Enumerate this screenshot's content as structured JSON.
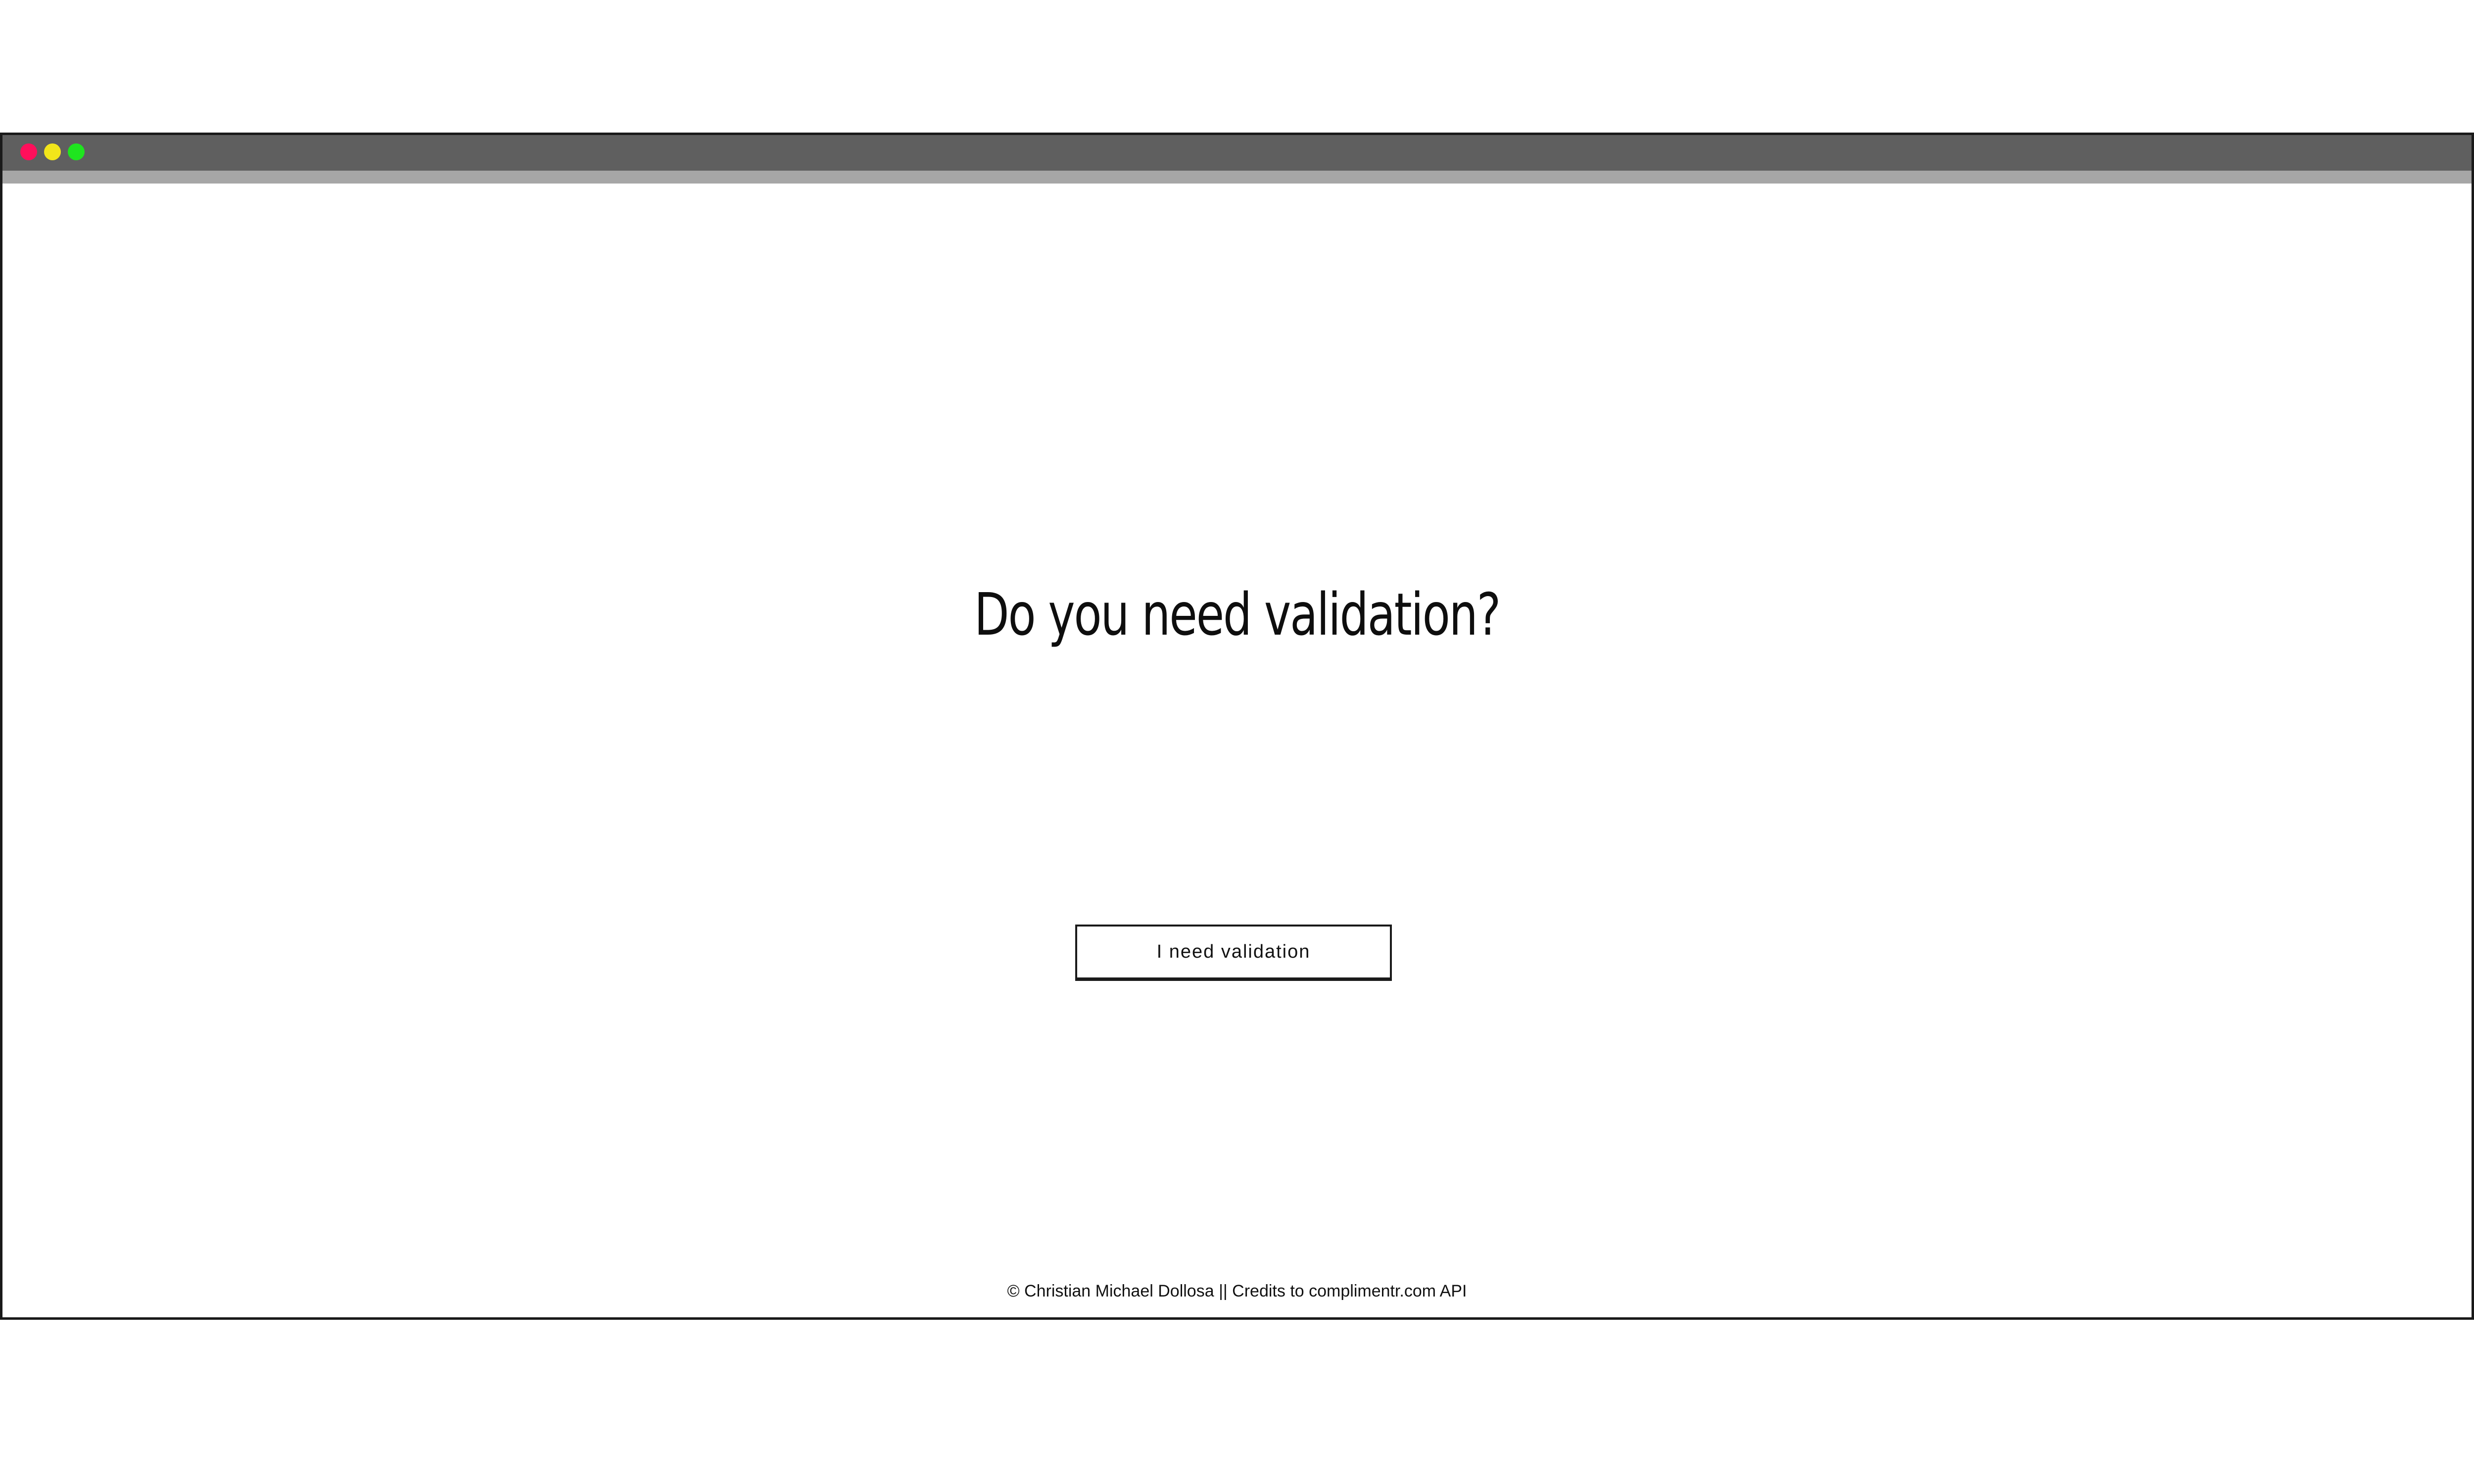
{
  "window": {
    "controls": [
      {
        "name": "close",
        "color": "#ff0f5b"
      },
      {
        "name": "minimize",
        "color": "#f2e51a"
      },
      {
        "name": "zoom",
        "color": "#1fe51f"
      }
    ]
  },
  "main": {
    "headline": "Do you need validation?",
    "button_label": "I need validation"
  },
  "footer": {
    "credit": "© Christian Michael Dollosa || Credits to complimentr.com API"
  }
}
